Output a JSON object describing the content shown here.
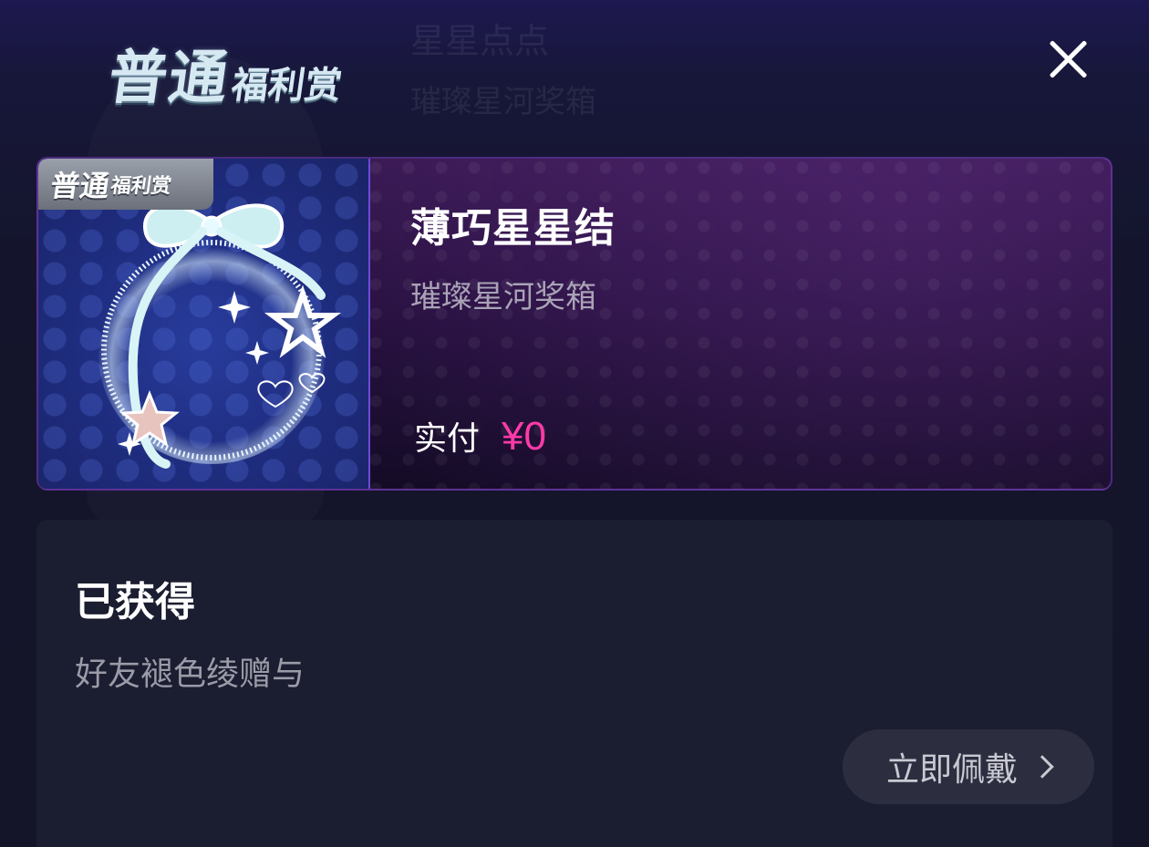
{
  "header": {
    "tier_main": "普通",
    "tier_sub": "福利赏",
    "ghost_title": "星星点点",
    "ghost_subtitle": "璀璨星河奖箱"
  },
  "reward": {
    "badge_main": "普通",
    "badge_sub": "福利赏",
    "name": "薄巧星星结",
    "source": "璀璨星河奖箱",
    "price_label": "实付",
    "price_value": "¥0",
    "price_color": "#ff3aa8"
  },
  "status": {
    "title": "已获得",
    "description": "好友褪色绫赠与",
    "action_label": "立即佩戴",
    "action_icon": "chevron-right-icon"
  },
  "icons": {
    "close": "close-icon"
  }
}
